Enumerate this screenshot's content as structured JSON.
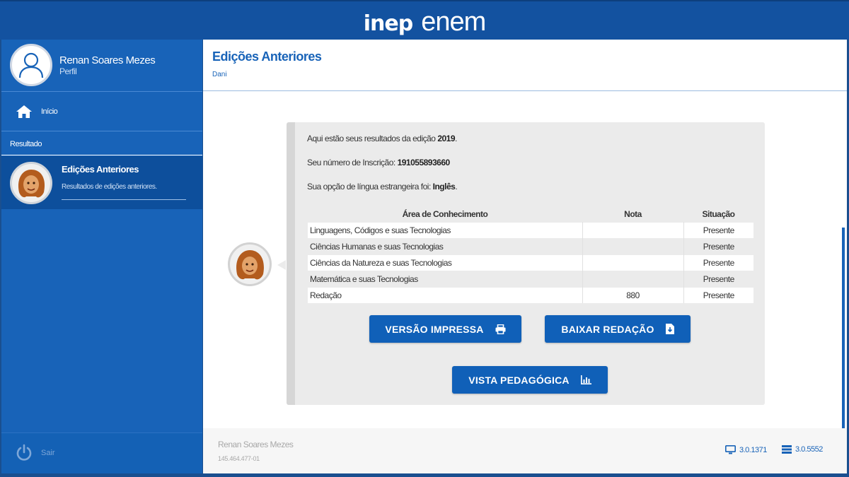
{
  "brand": {
    "inep": "inep",
    "enem": "enem"
  },
  "user": {
    "name": "Renan Soares Mezes",
    "profile_label": "Perfil",
    "id": "145.464.477-01"
  },
  "sidebar": {
    "home_label": "Início",
    "section_label": "Resultado",
    "active_item": {
      "title": "Edições Anteriores",
      "description": "Resultados de edições anteriores."
    },
    "logout_label": "Sair"
  },
  "page": {
    "title": "Edições Anteriores",
    "subtitle": "Dani"
  },
  "results": {
    "edition_text": "Aqui estão seus resultados da edição ",
    "edition_year": "2019",
    "inscription_text": "Seu número de Inscrição: ",
    "inscription_number": "191055893660",
    "language_text": "Sua opção de língua estrangeira foi: ",
    "language": "Inglês",
    "headers": {
      "area": "Área de Conhecimento",
      "nota": "Nota",
      "situacao": "Situação"
    },
    "rows": [
      {
        "area": "Linguagens, Códigos e suas Tecnologias",
        "nota": "",
        "situacao": "Presente"
      },
      {
        "area": "Ciências Humanas e suas Tecnologias",
        "nota": "",
        "situacao": "Presente"
      },
      {
        "area": "Ciências da Natureza e suas Tecnologias",
        "nota": "",
        "situacao": "Presente"
      },
      {
        "area": "Matemática e suas Tecnologias",
        "nota": "",
        "situacao": "Presente"
      },
      {
        "area": "Redação",
        "nota": "880",
        "situacao": "Presente"
      }
    ]
  },
  "buttons": {
    "print": "VERSÃO IMPRESSA",
    "download": "BAIXAR REDAÇÃO",
    "pedagogical": "VISTA PEDAGÓGICA"
  },
  "versions": {
    "client": "3.0.1371",
    "server": "3.0.5552"
  },
  "colors": {
    "primary": "#1863b8",
    "header": "#1352a0",
    "active": "#0d4f9c"
  },
  "icons": [
    "user-icon",
    "home-icon",
    "power-icon",
    "print-icon",
    "download-file-icon",
    "bar-chart-icon",
    "monitor-icon",
    "server-icon"
  ]
}
